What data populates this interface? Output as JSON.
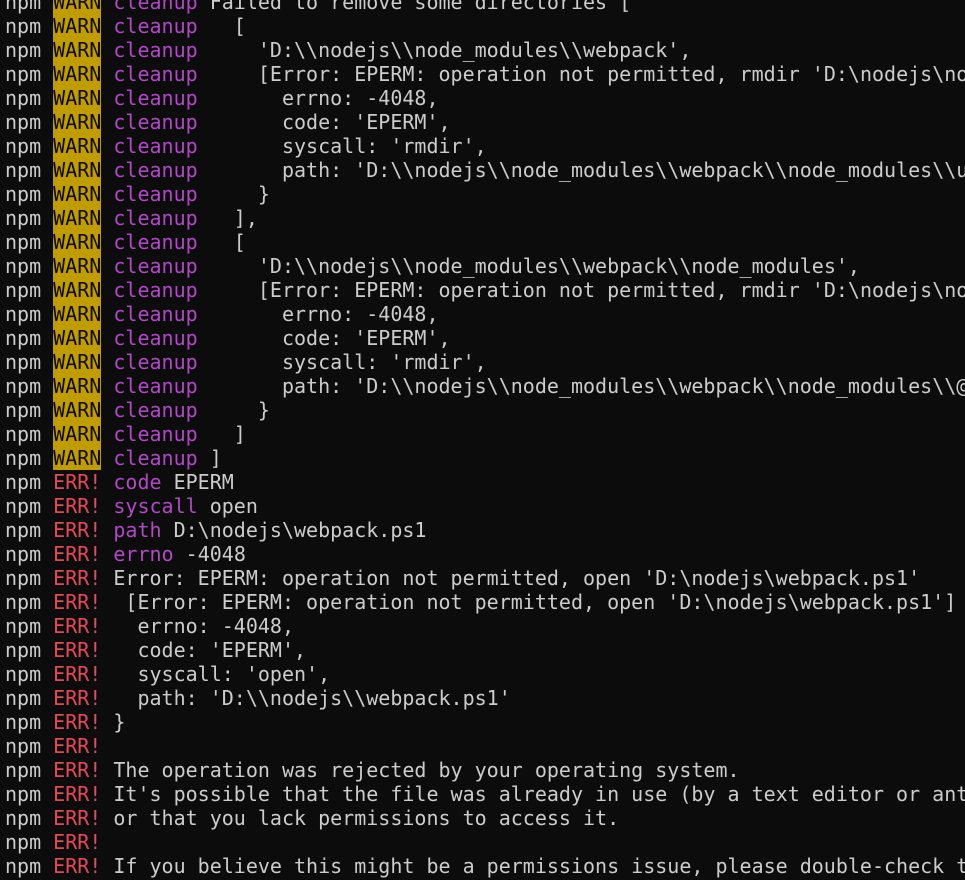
{
  "colors": {
    "background": "#0c0c0c",
    "text": "#cccccc",
    "warn_badge_bg": "#c19c00",
    "warn_badge_fg": "#0c0c0c",
    "err_label": "#e74856",
    "category": "#b148c6"
  },
  "lines": [
    {
      "prefix": "npm",
      "level": "WARN",
      "cat": "cleanup",
      "text": " Failed to remove some directories ["
    },
    {
      "prefix": "npm",
      "level": "WARN",
      "cat": "cleanup",
      "text": "   ["
    },
    {
      "prefix": "npm",
      "level": "WARN",
      "cat": "cleanup",
      "text": "     'D:\\\\nodejs\\\\node_modules\\\\webpack',"
    },
    {
      "prefix": "npm",
      "level": "WARN",
      "cat": "cleanup",
      "text": "     [Error: EPERM: operation not permitted, rmdir 'D:\\nodejs\\no"
    },
    {
      "prefix": "npm",
      "level": "WARN",
      "cat": "cleanup",
      "text": "       errno: -4048,"
    },
    {
      "prefix": "npm",
      "level": "WARN",
      "cat": "cleanup",
      "text": "       code: 'EPERM',"
    },
    {
      "prefix": "npm",
      "level": "WARN",
      "cat": "cleanup",
      "text": "       syscall: 'rmdir',"
    },
    {
      "prefix": "npm",
      "level": "WARN",
      "cat": "cleanup",
      "text": "       path: 'D:\\\\nodejs\\\\node_modules\\\\webpack\\\\node_modules\\\\u"
    },
    {
      "prefix": "npm",
      "level": "WARN",
      "cat": "cleanup",
      "text": "     }"
    },
    {
      "prefix": "npm",
      "level": "WARN",
      "cat": "cleanup",
      "text": "   ],"
    },
    {
      "prefix": "npm",
      "level": "WARN",
      "cat": "cleanup",
      "text": "   ["
    },
    {
      "prefix": "npm",
      "level": "WARN",
      "cat": "cleanup",
      "text": "     'D:\\\\nodejs\\\\node_modules\\\\webpack\\\\node_modules',"
    },
    {
      "prefix": "npm",
      "level": "WARN",
      "cat": "cleanup",
      "text": "     [Error: EPERM: operation not permitted, rmdir 'D:\\nodejs\\no"
    },
    {
      "prefix": "npm",
      "level": "WARN",
      "cat": "cleanup",
      "text": "       errno: -4048,"
    },
    {
      "prefix": "npm",
      "level": "WARN",
      "cat": "cleanup",
      "text": "       code: 'EPERM',"
    },
    {
      "prefix": "npm",
      "level": "WARN",
      "cat": "cleanup",
      "text": "       syscall: 'rmdir',"
    },
    {
      "prefix": "npm",
      "level": "WARN",
      "cat": "cleanup",
      "text": "       path: 'D:\\\\nodejs\\\\node_modules\\\\webpack\\\\node_modules\\\\@"
    },
    {
      "prefix": "npm",
      "level": "WARN",
      "cat": "cleanup",
      "text": "     }"
    },
    {
      "prefix": "npm",
      "level": "WARN",
      "cat": "cleanup",
      "text": "   ]"
    },
    {
      "prefix": "npm",
      "level": "WARN",
      "cat": "cleanup",
      "text": " ]"
    },
    {
      "prefix": "npm",
      "level": "ERR!",
      "cat": "code",
      "text": " EPERM"
    },
    {
      "prefix": "npm",
      "level": "ERR!",
      "cat": "syscall",
      "text": " open"
    },
    {
      "prefix": "npm",
      "level": "ERR!",
      "cat": "path",
      "text": " D:\\nodejs\\webpack.ps1"
    },
    {
      "prefix": "npm",
      "level": "ERR!",
      "cat": "errno",
      "text": " -4048"
    },
    {
      "prefix": "npm",
      "level": "ERR!",
      "cat": "",
      "text": "Error: EPERM: operation not permitted, open 'D:\\nodejs\\webpack.ps1'"
    },
    {
      "prefix": "npm",
      "level": "ERR!",
      "cat": "",
      "text": " [Error: EPERM: operation not permitted, open 'D:\\nodejs\\webpack.ps1']"
    },
    {
      "prefix": "npm",
      "level": "ERR!",
      "cat": "",
      "text": "  errno: -4048,"
    },
    {
      "prefix": "npm",
      "level": "ERR!",
      "cat": "",
      "text": "  code: 'EPERM',"
    },
    {
      "prefix": "npm",
      "level": "ERR!",
      "cat": "",
      "text": "  syscall: 'open',"
    },
    {
      "prefix": "npm",
      "level": "ERR!",
      "cat": "",
      "text": "  path: 'D:\\\\nodejs\\\\webpack.ps1'"
    },
    {
      "prefix": "npm",
      "level": "ERR!",
      "cat": "",
      "text": "}"
    },
    {
      "prefix": "npm",
      "level": "ERR!",
      "cat": "",
      "text": ""
    },
    {
      "prefix": "npm",
      "level": "ERR!",
      "cat": "",
      "text": "The operation was rejected by your operating system."
    },
    {
      "prefix": "npm",
      "level": "ERR!",
      "cat": "",
      "text": "It's possible that the file was already in use (by a text editor or ant"
    },
    {
      "prefix": "npm",
      "level": "ERR!",
      "cat": "",
      "text": "or that you lack permissions to access it."
    },
    {
      "prefix": "npm",
      "level": "ERR!",
      "cat": "",
      "text": ""
    },
    {
      "prefix": "npm",
      "level": "ERR!",
      "cat": "",
      "text": "If you believe this might be a permissions issue, please double-check t"
    }
  ]
}
